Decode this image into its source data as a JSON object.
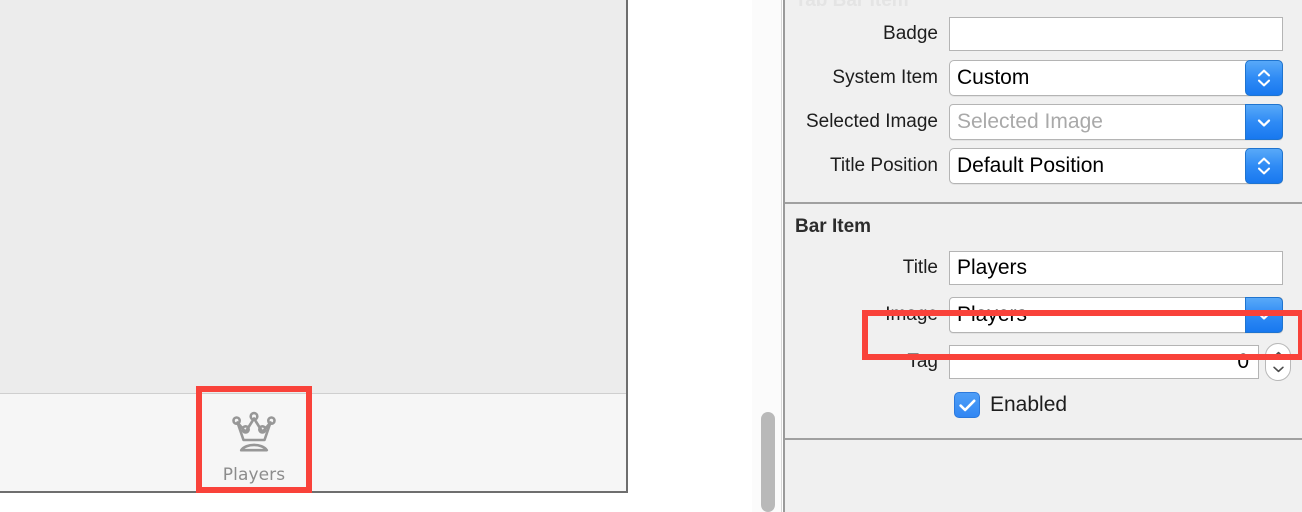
{
  "canvas": {
    "tab_bar": {
      "item": {
        "icon": "crown-icon",
        "label": "Players"
      }
    }
  },
  "inspector": {
    "sections": [
      {
        "name": "tab-bar-item",
        "title": "Tab Bar Item",
        "title_clipped": true,
        "rows": [
          {
            "name": "badge",
            "label": "Badge",
            "control": "text-field",
            "value": "",
            "placeholder": ""
          },
          {
            "name": "system-item",
            "label": "System Item",
            "control": "popup-button",
            "value": "Custom"
          },
          {
            "name": "selected-image",
            "label": "Selected Image",
            "control": "combo-box",
            "value": "",
            "placeholder": "Selected Image"
          },
          {
            "name": "title-position",
            "label": "Title Position",
            "control": "popup-button",
            "value": "Default Position"
          }
        ]
      },
      {
        "name": "bar-item",
        "title": "Bar Item",
        "title_clipped": false,
        "rows": [
          {
            "name": "title",
            "label": "Title",
            "control": "text-field",
            "value": "Players",
            "placeholder": ""
          },
          {
            "name": "image",
            "label": "Image",
            "control": "combo-box",
            "value": "Players",
            "placeholder": "",
            "highlighted": true
          },
          {
            "name": "tag",
            "label": "Tag",
            "control": "stepper-field",
            "value": "0",
            "placeholder": ""
          },
          {
            "name": "enabled",
            "label": "Enabled",
            "control": "checkbox",
            "checked": true
          }
        ]
      }
    ]
  },
  "highlights": {
    "accent_color": "#f9423a",
    "targets": [
      "tab-bar-item-players",
      "image-row"
    ]
  },
  "colors": {
    "panel_bg": "#f0f0f0",
    "canvas_bg": "#ececec",
    "tabbar_bg": "#f6f6f6",
    "accent_blue": "#2f8bf5",
    "tab_label_gray": "#8c8c8c",
    "highlight_red": "#f9423a"
  }
}
